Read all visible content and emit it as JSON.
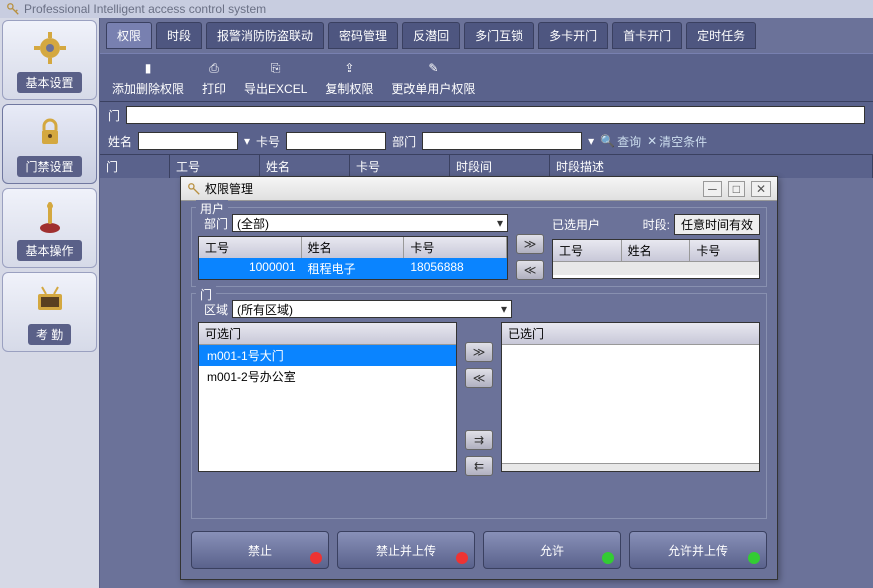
{
  "app_title": "Professional Intelligent access control system",
  "nav": [
    {
      "label": "基本设置"
    },
    {
      "label": "门禁设置"
    },
    {
      "label": "基本操作"
    },
    {
      "label": "考 勤"
    }
  ],
  "tabs": [
    "权限",
    "时段",
    "报警消防防盗联动",
    "密码管理",
    "反潜回",
    "多门互锁",
    "多卡开门",
    "首卡开门",
    "定时任务"
  ],
  "tools": [
    {
      "label": "添加删除权限"
    },
    {
      "label": "打印"
    },
    {
      "label": "导出EXCEL"
    },
    {
      "label": "复制权限"
    },
    {
      "label": "更改单用户权限"
    }
  ],
  "filters": {
    "door_label": "门",
    "name_label": "姓名",
    "card_label": "卡号",
    "dept_label": "部门",
    "search": "查询",
    "clear": "清空条件"
  },
  "grid_cols": [
    "门",
    "工号",
    "姓名",
    "卡号",
    "时段间",
    "时段描述"
  ],
  "dialog": {
    "title": "权限管理",
    "user_section": "用户",
    "dept_label": "部门",
    "dept_value": "(全部)",
    "selected_users": "已选用户",
    "time_label": "时段:",
    "time_value": "任意时间有效",
    "user_cols": {
      "emp": "工号",
      "name": "姓名",
      "card": "卡号"
    },
    "user_row": {
      "emp": "1000001",
      "name": "租程电子",
      "card": "18056888"
    },
    "door_section": "门",
    "area_label": "区域",
    "area_value": "(所有区域)",
    "available_doors": "可选门",
    "selected_doors": "已选门",
    "doors": [
      "m001-1号大门",
      "m001-2号办公室"
    ],
    "buttons": {
      "deny": "禁止",
      "deny_upload": "禁止并上传",
      "allow": "允许",
      "allow_upload": "允许并上传"
    }
  }
}
